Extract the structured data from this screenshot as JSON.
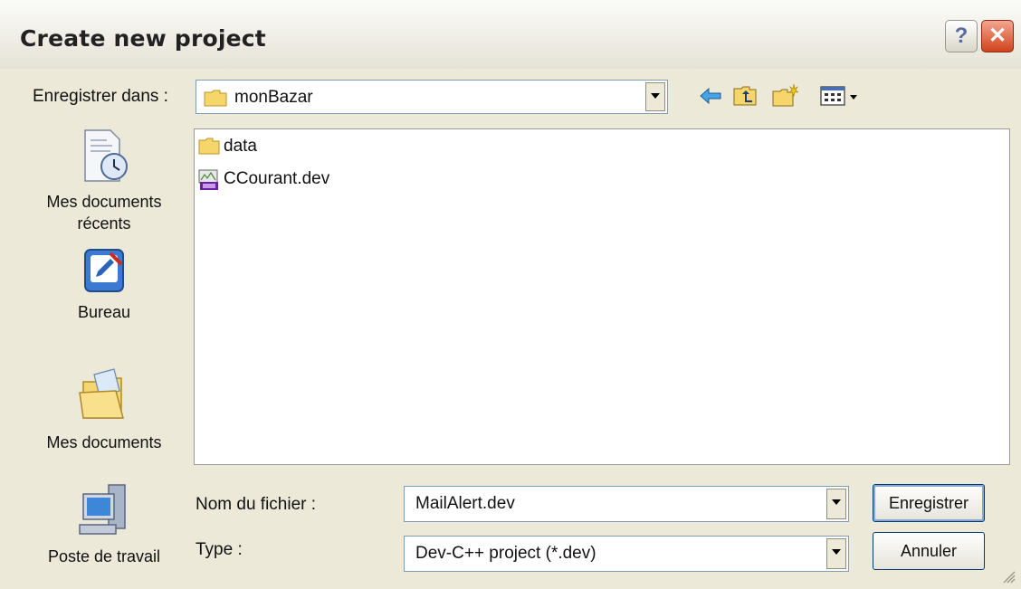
{
  "window": {
    "title": "Create new project"
  },
  "save_in": {
    "label": "Enregistrer dans :",
    "value": "monBazar"
  },
  "toolbar": {
    "back_icon": "back-arrow-icon",
    "up_icon": "up-folder-icon",
    "new_folder_icon": "new-folder-icon",
    "view_icon": "view-menu-icon"
  },
  "places": [
    {
      "label": "Mes documents récents",
      "icon": "recent-documents-icon"
    },
    {
      "label": "Bureau",
      "icon": "desktop-icon"
    },
    {
      "label": "Mes documents",
      "icon": "my-documents-icon"
    },
    {
      "label": "Poste de travail",
      "icon": "my-computer-icon"
    }
  ],
  "files": [
    {
      "name": "data",
      "icon": "folder-icon"
    },
    {
      "name": "CCourant.dev",
      "icon": "dev-file-icon"
    }
  ],
  "filename": {
    "label": "Nom du fichier :",
    "value": "MailAlert.dev"
  },
  "filetype": {
    "label": "Type :",
    "value": "Dev-C++ project (*.dev)"
  },
  "buttons": {
    "save": "Enregistrer",
    "cancel": "Annuler"
  },
  "colors": {
    "accent": "#003c74",
    "dialog_bg": "#ece9d8",
    "close": "#d0431a"
  }
}
